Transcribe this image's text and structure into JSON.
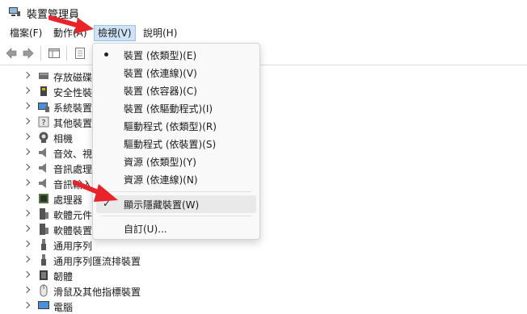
{
  "window": {
    "title": "裝置管理員"
  },
  "menu": {
    "file": "檔案(F)",
    "action": "動作(A)",
    "view": "檢視(V)",
    "help": "說明(H)"
  },
  "tree": {
    "items": [
      {
        "label": "存放磁碟",
        "icon": "storage-icon"
      },
      {
        "label": "安全性裝",
        "icon": "security-key-icon"
      },
      {
        "label": "系統裝置",
        "icon": "system-device-icon"
      },
      {
        "label": "其他裝置",
        "icon": "unknown-device-icon"
      },
      {
        "label": "相機",
        "icon": "camera-icon"
      },
      {
        "label": "音效、視",
        "icon": "speaker-icon"
      },
      {
        "label": "音訊處理",
        "icon": "speaker-icon"
      },
      {
        "label": "音訊輸入",
        "icon": "speaker-icon"
      },
      {
        "label": "處理器",
        "icon": "cpu-icon"
      },
      {
        "label": "軟體元件",
        "icon": "software-component-icon"
      },
      {
        "label": "軟體裝置",
        "icon": "software-device-icon"
      },
      {
        "label": "通用序列",
        "icon": "usb-icon"
      },
      {
        "label": "通用序列匯流排裝置",
        "icon": "usb-icon"
      },
      {
        "label": "韌體",
        "icon": "firmware-icon"
      },
      {
        "label": "滑鼠及其他指標裝置",
        "icon": "mouse-icon"
      },
      {
        "label": "電腦",
        "icon": "computer-icon"
      }
    ]
  },
  "view_menu": {
    "items": [
      {
        "label": "裝置 (依類型)(E)",
        "mark": "bullet"
      },
      {
        "label": "裝置 (依連線)(V)",
        "mark": ""
      },
      {
        "label": "裝置 (依容器)(C)",
        "mark": ""
      },
      {
        "label": "裝置 (依驅動程式)(I)",
        "mark": ""
      },
      {
        "label": "驅動程式 (依類型)(R)",
        "mark": ""
      },
      {
        "label": "驅動程式 (依裝置)(S)",
        "mark": ""
      },
      {
        "label": "資源 (依類型)(Y)",
        "mark": ""
      },
      {
        "label": "資源 (依連線)(N)",
        "mark": ""
      }
    ],
    "show_hidden": {
      "label": "顯示隱藏裝置(W)",
      "checkmark": "✓"
    },
    "customize": {
      "label": "自訂(U)..."
    }
  },
  "colors": {
    "annotation_arrow": "#e8242a",
    "menu_active_bg": "#cfe3f7"
  }
}
